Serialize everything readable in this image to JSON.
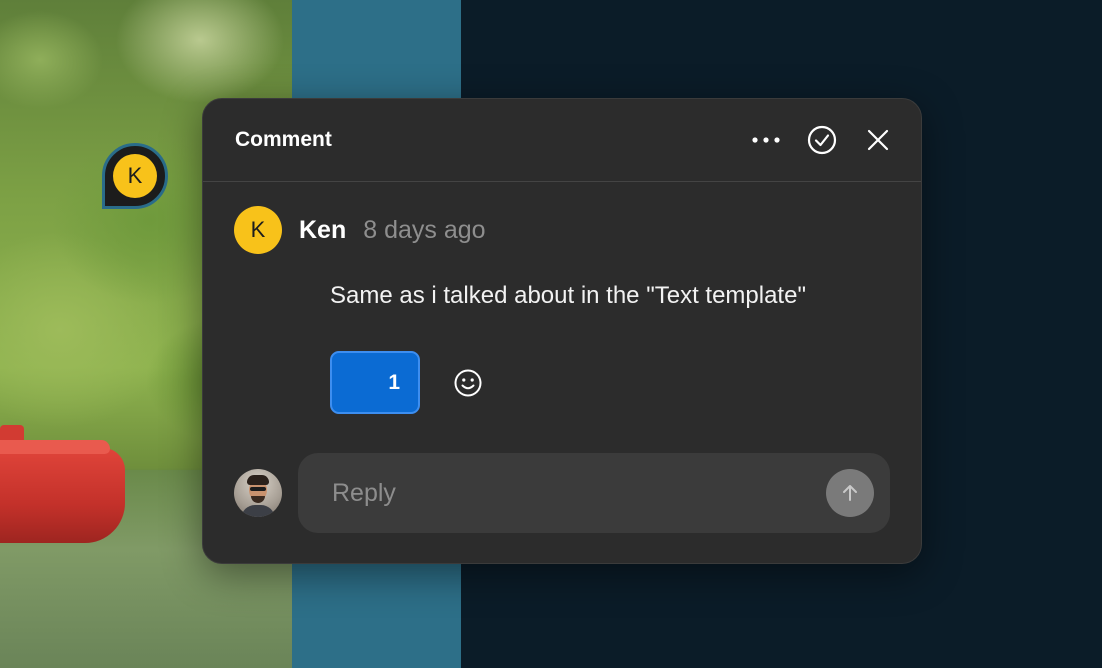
{
  "canvas": {
    "pin_initial": "K",
    "pin_color": "#f8c21a"
  },
  "comment_popup": {
    "title": "Comment",
    "icons": {
      "more": "more-horizontal-icon",
      "resolve": "check-circle-icon",
      "close": "close-icon"
    },
    "comment": {
      "avatar_initial": "K",
      "avatar_color": "#f8c21a",
      "author": "Ken",
      "timestamp": "8 days ago",
      "text": "Same as i talked about in the \"Text template\"",
      "reaction": {
        "count": "1",
        "color": "#0b6bd3"
      },
      "add_reaction_icon": "smiley-icon"
    },
    "reply": {
      "placeholder": "Reply",
      "value": "",
      "send_icon": "arrow-up-icon"
    }
  }
}
